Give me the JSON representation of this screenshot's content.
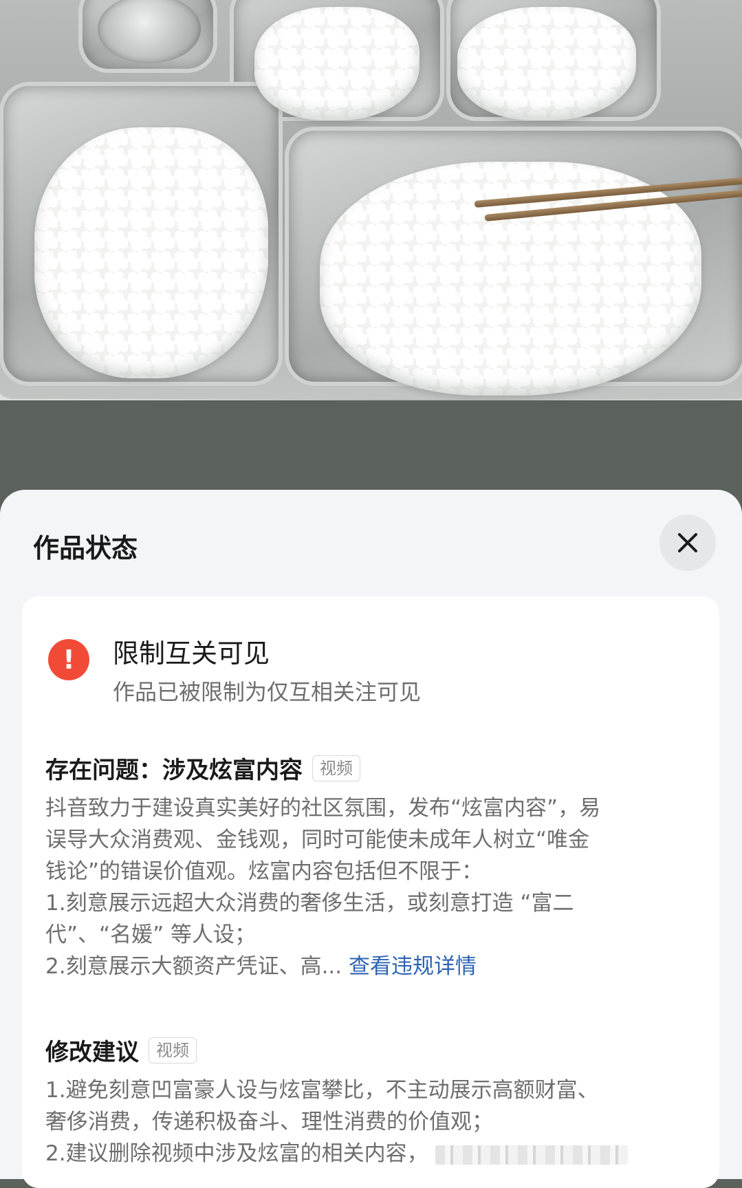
{
  "sheet": {
    "title": "作品状态",
    "close_icon": "close-icon"
  },
  "status": {
    "icon": "warning-circle-icon",
    "icon_color": "#f14b37",
    "icon_glyph": "!",
    "title": "限制互关可见",
    "subtitle": "作品已被限制为仅互相关注可见"
  },
  "problem": {
    "heading": "存在问题：涉及炫富内容",
    "tag": "视频",
    "lines": [
      "抖音致力于建设真实美好的社区氛围，发布“炫富内容”，易",
      "误导大众消费观、金钱观，同时可能使未成年人树立“唯金",
      "钱论”的错误价值观。炫富内容包括但不限于：",
      "1.刻意展示远超大众消费的奢侈生活，或刻意打造 “富二",
      "代”、“名媛” 等人设；"
    ],
    "last_line": "2.刻意展示大额资产凭证、高...",
    "link": "查看违规详情",
    "link_color": "#2d64b3"
  },
  "suggestion": {
    "heading": "修改建议",
    "tag": "视频",
    "lines": [
      "1.避免刻意凹富豪人设与炫富攀比，不主动展示高额财富、",
      "奢侈消费，传递积极奋斗、理性消费的价值观；"
    ],
    "last_line": "2.建议删除视频中涉及炫富的相关内容，"
  }
}
